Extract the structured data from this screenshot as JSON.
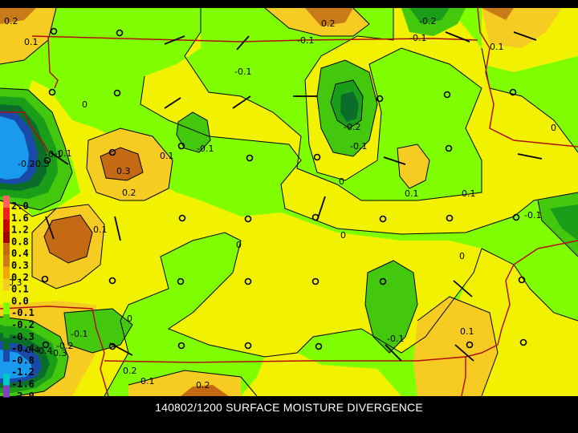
{
  "caption": "140802/1200 SURFACE MOISTURE DIVERGENCE",
  "legend": [
    {
      "label": "2.0",
      "color": "#ff6060"
    },
    {
      "label": "1.6",
      "color": "#ee2020"
    },
    {
      "label": "1.2",
      "color": "#c80000"
    },
    {
      "label": "0.8",
      "color": "#a00000"
    },
    {
      "label": "0.4",
      "color": "#c46a14"
    },
    {
      "label": "0.3",
      "color": "#cc7a1a"
    },
    {
      "label": "0.2",
      "color": "#f0a800"
    },
    {
      "label": "0.1",
      "color": "#f7cc22"
    },
    {
      "label": "0.0",
      "color": "#f2f200"
    },
    {
      "label": "-0.1",
      "color": "#80ff00"
    },
    {
      "label": "-0.2",
      "color": "#44c80e"
    },
    {
      "label": "-0.3",
      "color": "#1a9e1a"
    },
    {
      "label": "-0.4",
      "color": "#0a6e2a"
    },
    {
      "label": "-0.8",
      "color": "#1a4aa8"
    },
    {
      "label": "-1.2",
      "color": "#1a9aee"
    },
    {
      "label": "-1.6",
      "color": "#00c8c8"
    },
    {
      "label": "-2.0",
      "color": "#8040c0"
    }
  ],
  "contour_labels": [
    {
      "text": "0.2"
    },
    {
      "text": "0.1"
    },
    {
      "text": "0.2"
    },
    {
      "text": "-0.2"
    },
    {
      "text": "-0.1"
    },
    {
      "text": "-0.1"
    },
    {
      "text": "0.1"
    },
    {
      "text": "0"
    },
    {
      "text": "-0.1"
    },
    {
      "text": "-0.2"
    },
    {
      "text": "-0.1"
    },
    {
      "text": "0"
    },
    {
      "text": "-0.1"
    },
    {
      "text": "-0.1"
    },
    {
      "text": "0.1"
    },
    {
      "text": "0.3"
    },
    {
      "text": "0.2"
    },
    {
      "text": "0.1"
    },
    {
      "text": "0"
    },
    {
      "text": "0.1"
    },
    {
      "text": "-0.1"
    },
    {
      "text": "0.2"
    },
    {
      "text": "0"
    },
    {
      "text": "0"
    },
    {
      "text": "0"
    },
    {
      "text": "0.1"
    },
    {
      "text": "-0.1"
    },
    {
      "text": "0"
    },
    {
      "text": "-0.1"
    },
    {
      "text": "0.1"
    },
    {
      "text": "0.1"
    },
    {
      "text": "0.2"
    },
    {
      "text": "-0.1"
    },
    {
      "text": "-0.2"
    },
    {
      "text": "-0.4"
    },
    {
      "text": "-0.3"
    },
    {
      "text": "-0.4"
    },
    {
      "text": "-0.3"
    },
    {
      "text": "-0.2"
    },
    {
      "text": "0.3"
    }
  ],
  "colors": {
    "background": "#000000",
    "state_border": "#b01010",
    "contour_line": "#000000"
  }
}
